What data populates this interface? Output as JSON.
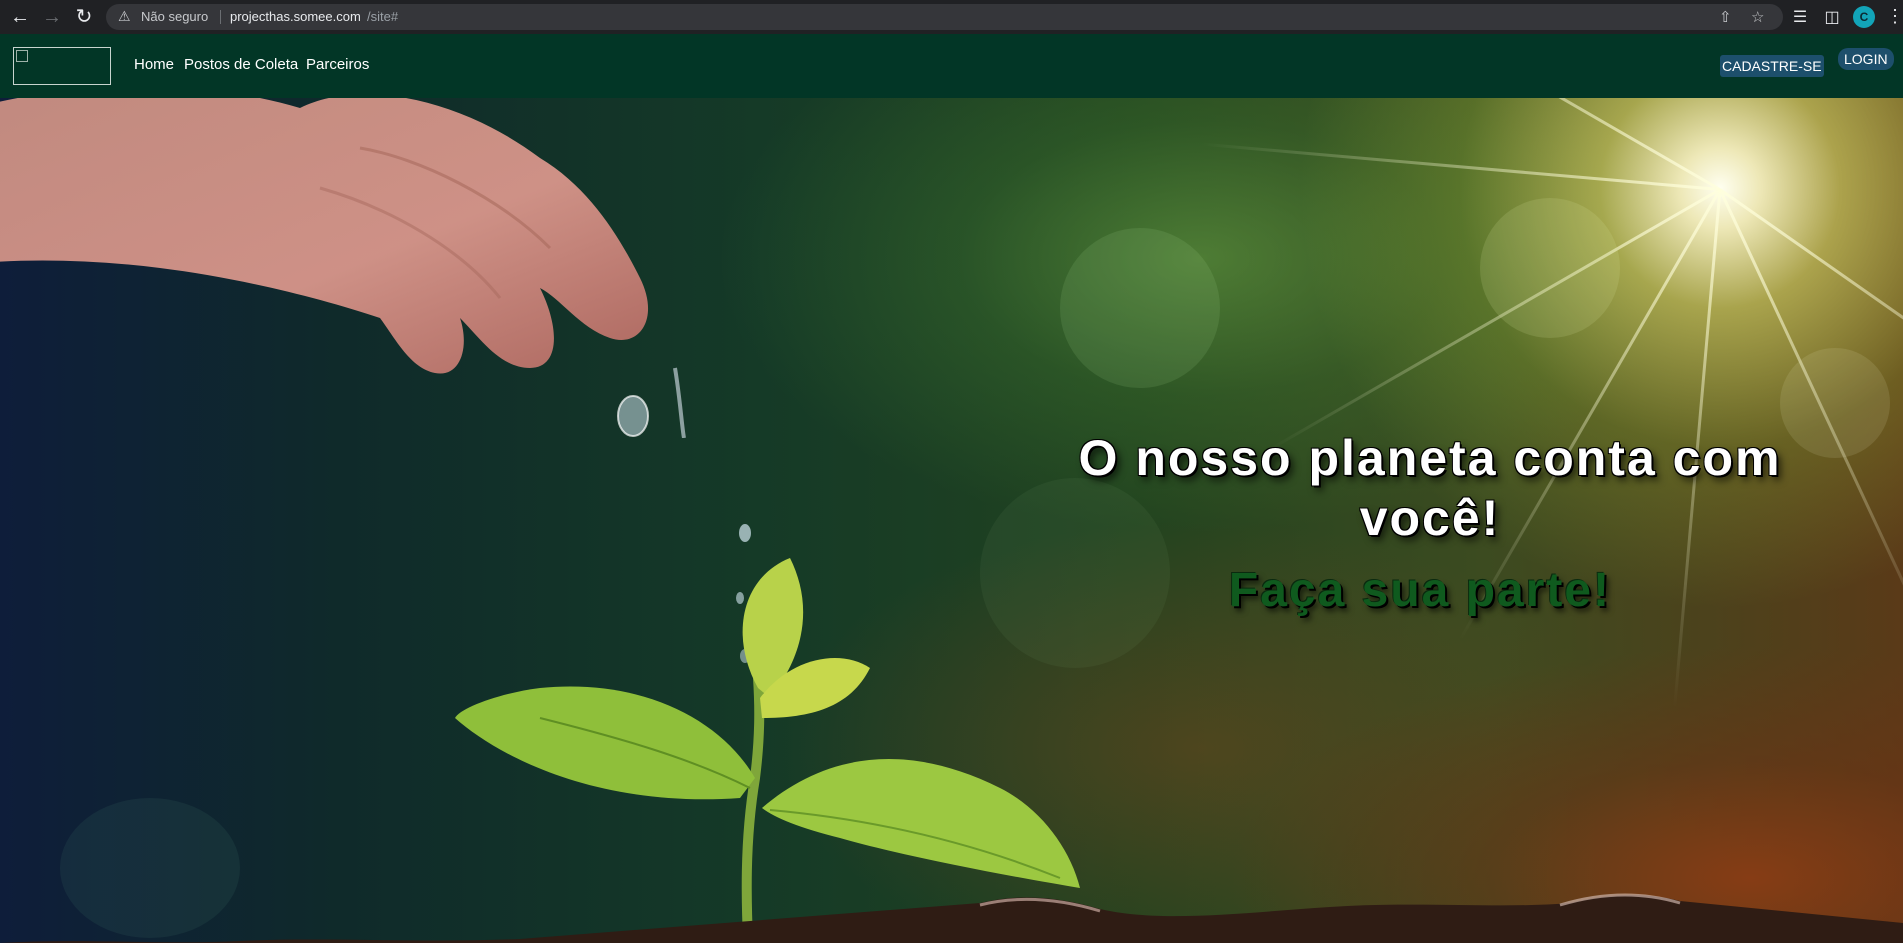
{
  "browser": {
    "security_text": "Não seguro",
    "url_host": "projecthas.somee.com",
    "url_path": "/site#",
    "profile_initial": "C",
    "icons": {
      "back": "arrow-left-icon",
      "forward": "arrow-right-icon",
      "reload": "reload-icon",
      "warning": "warning-icon",
      "share": "share-icon",
      "bookmark": "star-icon",
      "reading_list": "reading-list-icon",
      "side_panel": "side-panel-icon",
      "menu": "kebab-menu-icon"
    }
  },
  "site": {
    "nav": {
      "links": [
        "Home",
        "Postos de Coleta",
        "Parceiros"
      ],
      "signup_label": "CADASTRE-SE",
      "login_label": "LOGIN"
    },
    "hero": {
      "title": "O nosso planeta conta com você!",
      "subtitle": "Faça sua parte!"
    }
  },
  "colors": {
    "navbar": "#023626",
    "button": "#1d4f6c",
    "subtitle": "#0f5a1e",
    "browser_chrome": "#202124"
  }
}
